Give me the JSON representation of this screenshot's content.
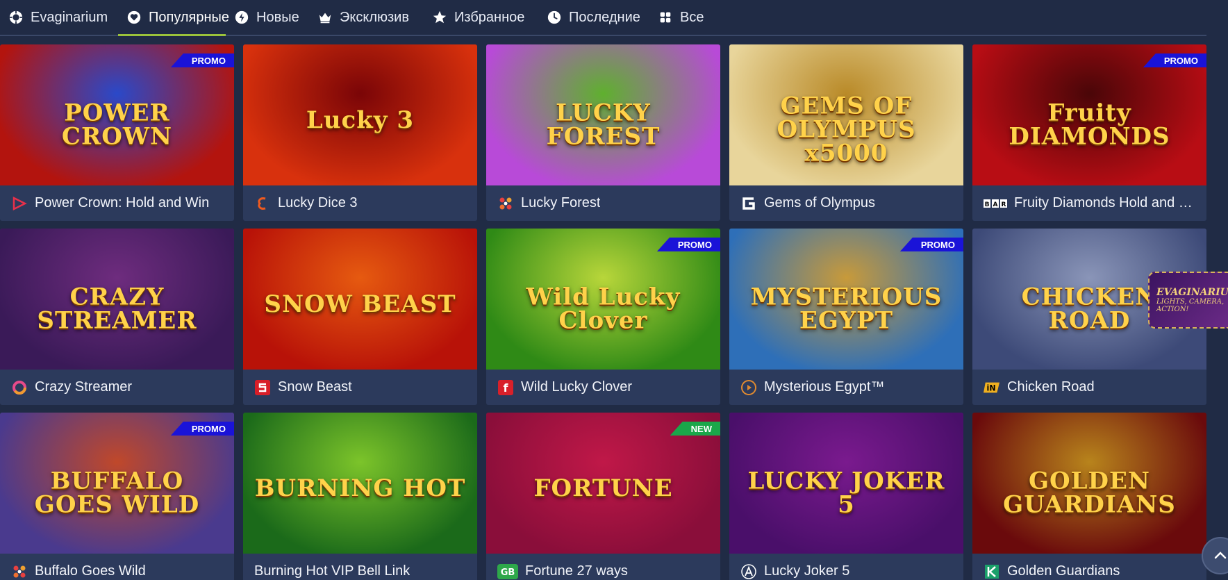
{
  "nav": {
    "items": [
      {
        "label": "Evaginarium",
        "icon": "chip-icon",
        "active": false
      },
      {
        "label": "Популярные",
        "icon": "heart-chip-icon",
        "active": true
      },
      {
        "label": "Новые",
        "icon": "lightning-chip-icon",
        "active": false
      },
      {
        "label": "Эксклюзив",
        "icon": "crown-icon",
        "active": false
      },
      {
        "label": "Избранное",
        "icon": "star-icon",
        "active": false
      },
      {
        "label": "Последние",
        "icon": "clock-icon",
        "active": false
      },
      {
        "label": "Все",
        "icon": "grid-icon",
        "active": false
      }
    ]
  },
  "games": [
    {
      "title": "Power Crown: Hold and Win",
      "art_text": "POWER CROWN",
      "badge": "PROMO",
      "provider_icon": "play-triangle-icon",
      "colors": [
        "#b3140e",
        "#2a49c9"
      ]
    },
    {
      "title": "Lucky Dice 3",
      "art_text": "Lucky 3",
      "badge": "",
      "provider_icon": "e-logo-icon",
      "colors": [
        "#d8310d",
        "#7a0507"
      ]
    },
    {
      "title": "Lucky Forest",
      "art_text": "LUCKY FOREST",
      "badge": "",
      "provider_icon": "dots-icon",
      "colors": [
        "#b84ad8",
        "#5fb02e"
      ]
    },
    {
      "title": "Gems of Olympus",
      "art_text": "GEMS OF OLYMPUS x5000",
      "badge": "",
      "provider_icon": "g-logo-icon",
      "colors": [
        "#e8d59b",
        "#b98a28"
      ]
    },
    {
      "title": "Fruity Diamonds Hold and S...",
      "art_text": "Fruity DIAMONDS",
      "badge": "PROMO",
      "provider_icon": "bar-logo-icon",
      "colors": [
        "#b80d14",
        "#4a0608"
      ]
    },
    {
      "title": "Crazy Streamer",
      "art_text": "CRAZY STREAMER",
      "badge": "",
      "provider_icon": "ring-icon",
      "colors": [
        "#3a1a58",
        "#6e2c7e"
      ]
    },
    {
      "title": "Snow Beast",
      "art_text": "SNOW BEAST",
      "badge": "",
      "provider_icon": "s-logo-icon",
      "colors": [
        "#b81208",
        "#e65a10"
      ]
    },
    {
      "title": "Wild Lucky Clover",
      "art_text": "Wild Lucky Clover",
      "badge": "PROMO",
      "provider_icon": "f-logo-icon",
      "colors": [
        "#2f8a16",
        "#b8d63a"
      ]
    },
    {
      "title": "Mysterious Egypt™",
      "art_text": "MYSTERIOUS EGYPT",
      "badge": "PROMO",
      "provider_icon": "play-circle-icon",
      "colors": [
        "#2e6fb8",
        "#c89a3a"
      ]
    },
    {
      "title": "Chicken Road",
      "art_text": "CHICKEN ROAD",
      "badge": "",
      "provider_icon": "in-logo-icon",
      "colors": [
        "#3d4a78",
        "#8a95b8"
      ]
    },
    {
      "title": "Buffalo Goes Wild",
      "art_text": "BUFFALO GOES WILD",
      "badge": "PROMO",
      "provider_icon": "dots-icon",
      "colors": [
        "#4a3a8e",
        "#c0482a"
      ]
    },
    {
      "title": "Burning Hot VIP Bell Link",
      "art_text": "BURNING HOT",
      "badge": "",
      "provider_icon": "",
      "colors": [
        "#1b6a1a",
        "#7cc42a"
      ]
    },
    {
      "title": "Fortune 27 ways",
      "art_text": "FORTUNE",
      "badge": "NEW",
      "provider_icon": "gb-logo-icon",
      "colors": [
        "#8a0e3a",
        "#c01848"
      ]
    },
    {
      "title": "Lucky Joker 5",
      "art_text": "LUCKY JOKER 5",
      "badge": "",
      "provider_icon": "a-logo-icon",
      "colors": [
        "#4a0f6a",
        "#7a1a8e"
      ]
    },
    {
      "title": "Golden Guardians",
      "art_text": "GOLDEN GUARDIANS",
      "badge": "",
      "provider_icon": "k-logo-icon",
      "colors": [
        "#6a0a0c",
        "#b8841c"
      ]
    }
  ],
  "side_banner": {
    "title": "EVAGINARIUM",
    "subtitle": "LIGHTS, CAMERA, ACTION!"
  },
  "colors": {
    "background": "#202b45",
    "card": "#2c3a5c",
    "active_tab": "#9bc23b",
    "promo_badge": "#1a13d8",
    "new_badge": "#1aa74a"
  }
}
